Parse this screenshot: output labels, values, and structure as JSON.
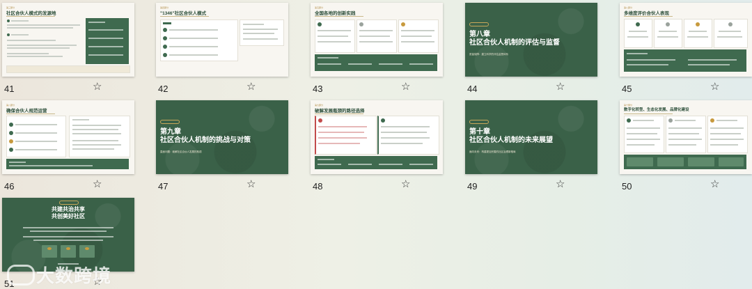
{
  "slides": [
    {
      "num": "41",
      "tag": "第三部分",
      "title": "社区合伙人模式的发源地"
    },
    {
      "num": "42",
      "tag": "第四部分",
      "title": "\"1346\"社区合伙人模式"
    },
    {
      "num": "43",
      "tag": "第五部分",
      "title": "全国各地的创新实践"
    },
    {
      "num": "44",
      "title_line1": "第八章",
      "title_line2": "社区合伙人机制的评估与监督",
      "subtitle": "质量保障：建立科学的评估监督体系"
    },
    {
      "num": "45",
      "tag": "第八部分",
      "title": "多维度评价合伙人表现"
    },
    {
      "num": "46",
      "tag": "第八部分",
      "title": "确保合伙人规范运营"
    },
    {
      "num": "47",
      "title_line1": "第九章",
      "title_line2": "社区合伙人机制的挑战与对策",
      "subtitle": "直面问题：破解社区合伙人发展的瓶颈"
    },
    {
      "num": "48",
      "tag": "第九部分",
      "title": "破解发展瓶颈的路径选择"
    },
    {
      "num": "49",
      "title_line1": "第十章",
      "title_line2": "社区合伙人机制的未来展望",
      "subtitle": "面向未来：构建更加完善的社区治理新格局"
    },
    {
      "num": "50",
      "tag": "第十部分",
      "title": "数字化转型、生态化发展、品牌化建设"
    },
    {
      "num": "51",
      "title_line1": "共建共治共享",
      "title_line2": "共创美好社区"
    }
  ],
  "star_icon": "☆",
  "watermark": {
    "text": "大数跨境"
  },
  "colors": {
    "primary_green": "#3f6a4f",
    "gold": "#c79a3e",
    "light_bg": "#f8f6f1"
  }
}
